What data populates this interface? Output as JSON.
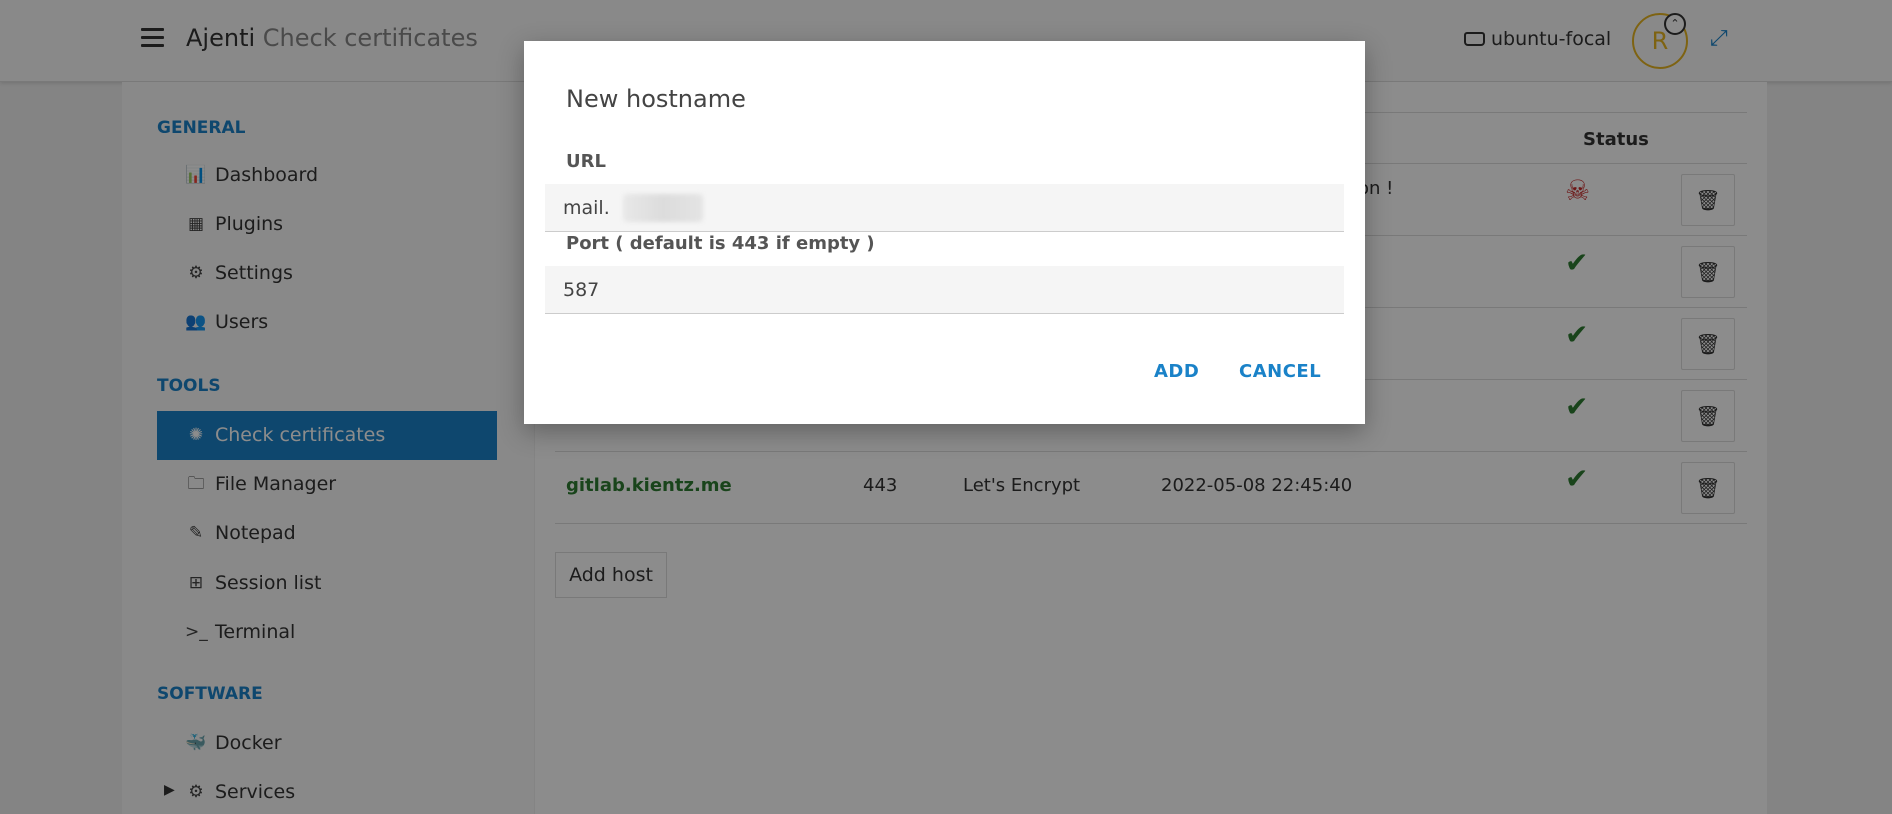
{
  "app": {
    "brand": "Ajenti",
    "page": "Check certificates",
    "host": "ubuntu-focal",
    "avatar_letter": "R"
  },
  "sidebar": {
    "sections": [
      {
        "title": "GENERAL",
        "items": [
          {
            "label": "Dashboard",
            "icon": "bar-chart-icon"
          },
          {
            "label": "Plugins",
            "icon": "grid-icon"
          },
          {
            "label": "Settings",
            "icon": "gear-icon"
          },
          {
            "label": "Users",
            "icon": "users-icon"
          }
        ]
      },
      {
        "title": "TOOLS",
        "items": [
          {
            "label": "Check certificates",
            "icon": "certificate-icon",
            "active": true
          },
          {
            "label": "File Manager",
            "icon": "folder-icon"
          },
          {
            "label": "Notepad",
            "icon": "pencil-icon"
          },
          {
            "label": "Session list",
            "icon": "sitemap-icon"
          },
          {
            "label": "Terminal",
            "icon": "terminal-icon"
          }
        ]
      },
      {
        "title": "SOFTWARE",
        "items": [
          {
            "label": "Docker",
            "icon": "docker-icon"
          },
          {
            "label": "Services",
            "icon": "gears-icon"
          }
        ]
      }
    ]
  },
  "table": {
    "status_header": "Status",
    "rows": [
      {
        "name": "",
        "port": "",
        "issuer": "",
        "date": "",
        "message": "ion !",
        "status": "error"
      },
      {
        "name": "",
        "port": "",
        "issuer": "",
        "date": "",
        "message": "",
        "status": "ok"
      },
      {
        "name": "",
        "port": "",
        "issuer": "",
        "date": "",
        "message": "",
        "status": "ok"
      },
      {
        "name": "",
        "port": "",
        "issuer": "",
        "date": "",
        "message": "",
        "status": "ok"
      },
      {
        "name": "gitlab.kientz.me",
        "port": "443",
        "issuer": "Let's Encrypt",
        "date": "2022-05-08 22:45:40",
        "message": "",
        "status": "ok"
      }
    ],
    "add_host_label": "Add host"
  },
  "modal": {
    "title": "New hostname",
    "url_label": "URL",
    "url_value": "mail.",
    "port_label": "Port ( default is 443 if empty )",
    "port_value": "587",
    "add_label": "ADD",
    "cancel_label": "CANCEL"
  },
  "colors": {
    "accent": "#1a82c8",
    "ok": "#2e7d32",
    "error": "#c62828",
    "avatar": "#e6b422"
  }
}
